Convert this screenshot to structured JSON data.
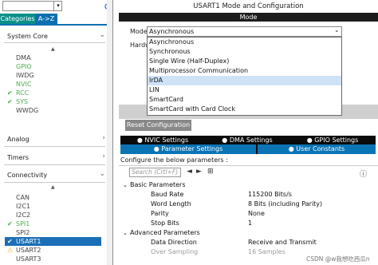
{
  "left": {
    "tabs": {
      "categories": "Categories",
      "az": "A->Z"
    },
    "system_core": {
      "title": "System Core",
      "items": [
        {
          "label": "DMA",
          "status": "plain"
        },
        {
          "label": "GPIO",
          "status": "green"
        },
        {
          "label": "IWDG",
          "status": "plain"
        },
        {
          "label": "NVIC",
          "status": "green"
        },
        {
          "label": "RCC",
          "status": "checked"
        },
        {
          "label": "SYS",
          "status": "checked"
        },
        {
          "label": "WWDG",
          "status": "plain"
        }
      ]
    },
    "analog": {
      "title": "Analog"
    },
    "timers": {
      "title": "Timers"
    },
    "connectivity": {
      "title": "Connectivity",
      "items": [
        {
          "label": "CAN",
          "status": "plain"
        },
        {
          "label": "I2C1",
          "status": "plain"
        },
        {
          "label": "I2C2",
          "status": "plain"
        },
        {
          "label": "SPI1",
          "status": "checked"
        },
        {
          "label": "SPI2",
          "status": "plain"
        },
        {
          "label": "USART1",
          "status": "selected"
        },
        {
          "label": "USART2",
          "status": "warning"
        },
        {
          "label": "USART3",
          "status": "plain"
        }
      ]
    }
  },
  "right": {
    "title": "USART1 Mode and Configuration",
    "mode_header": "Mode",
    "mode_label": "Mode",
    "hardware_label": "Hardw",
    "mode_value": "Asynchronous",
    "mode_options": [
      "Asynchronous",
      "Synchronous",
      "Single Wire (Half-Duplex)",
      "Multiprocessor Communication",
      "IrDA",
      "LIN",
      "SmartCard",
      "SmartCard with Card Clock"
    ],
    "highlighted_option": "IrDA",
    "reset_button": "Reset Configuration",
    "tabs_row1": [
      "NVIC Settings",
      "DMA Settings",
      "GPIO Settings"
    ],
    "tabs_row2": [
      "Parameter Settings",
      "User Constants"
    ],
    "configure_text": "Configure the below parameters :",
    "search_placeholder": "Search (Crtl+F)",
    "sections": [
      {
        "title": "Basic Parameters",
        "params": [
          {
            "name": "Baud Rate",
            "value": "115200 Bits/s"
          },
          {
            "name": "Word Length",
            "value": "8 Bits (including Parity)"
          },
          {
            "name": "Parity",
            "value": "None"
          },
          {
            "name": "Stop Bits",
            "value": "1"
          }
        ]
      },
      {
        "title": "Advanced Parameters",
        "params": [
          {
            "name": "Data Direction",
            "value": "Receive and Transmit"
          },
          {
            "name": "Over Sampling",
            "value": "16 Samples"
          }
        ]
      }
    ],
    "watermark": "CSDN @w我想吃西瓜n"
  },
  "colors": {
    "tab_categories": "#0a8f8a",
    "tab_active": "#0b74b5",
    "tab_dark": "#0b0b0b",
    "selected_row": "#1a6fb6",
    "green": "#4caf50",
    "highlight_option": "#cfe3f7"
  }
}
